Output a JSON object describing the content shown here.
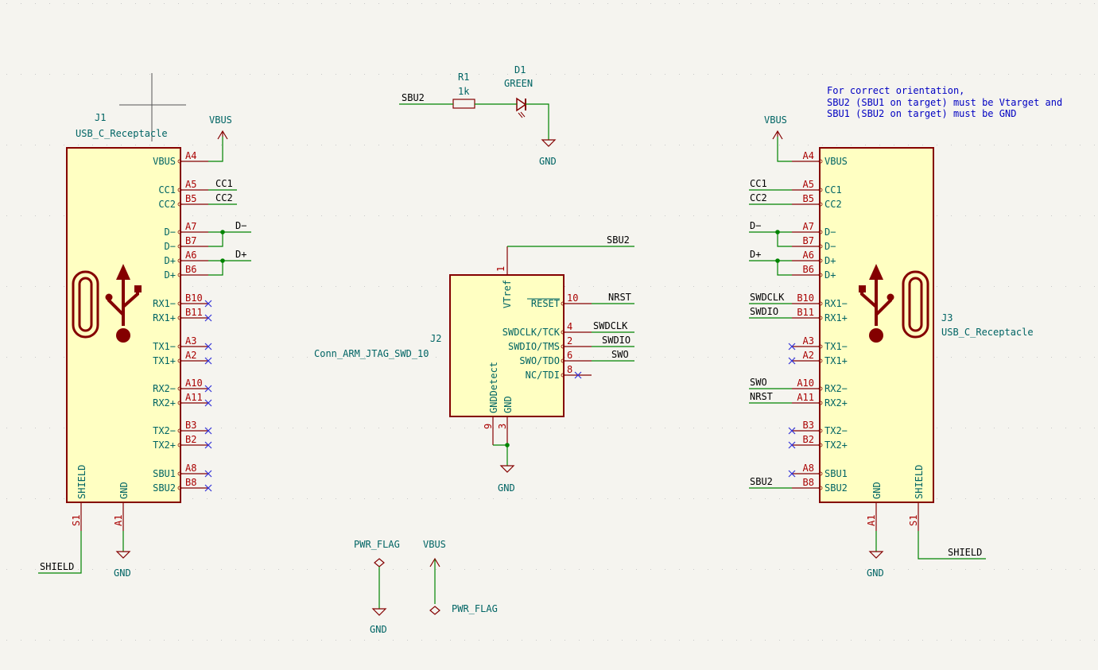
{
  "colors": {
    "background": "#f5f4ef",
    "symbol_body": "#ffffc2",
    "symbol_outline": "#840000",
    "wire": "#008400",
    "pin_number": "#a90000",
    "pin_name": "#006464",
    "note": "#0000c2",
    "no_connect": "#3434d8"
  },
  "j1": {
    "ref": "J1",
    "value": "USB_C_Receptacle",
    "right_pins": [
      {
        "name": "VBUS",
        "num": "A4"
      },
      {
        "name": "CC1",
        "num": "A5"
      },
      {
        "name": "CC2",
        "num": "B5"
      },
      {
        "name": "D−",
        "num": "A7"
      },
      {
        "name": "D−",
        "num": "B7"
      },
      {
        "name": "D+",
        "num": "A6"
      },
      {
        "name": "D+",
        "num": "B6"
      },
      {
        "name": "RX1−",
        "num": "B10"
      },
      {
        "name": "RX1+",
        "num": "B11"
      },
      {
        "name": "TX1−",
        "num": "A3"
      },
      {
        "name": "TX1+",
        "num": "A2"
      },
      {
        "name": "RX2−",
        "num": "A10"
      },
      {
        "name": "RX2+",
        "num": "A11"
      },
      {
        "name": "TX2−",
        "num": "B3"
      },
      {
        "name": "TX2+",
        "num": "B2"
      },
      {
        "name": "SBU1",
        "num": "A8"
      },
      {
        "name": "SBU2",
        "num": "B8"
      }
    ],
    "bottom_pins": [
      {
        "name": "SHIELD",
        "num": "S1"
      },
      {
        "name": "GND",
        "num": "A1"
      }
    ],
    "nets": {
      "vbus": "VBUS",
      "cc1": "CC1",
      "cc2": "CC2",
      "dm": "D−",
      "dp": "D+",
      "shield": "SHIELD",
      "gnd": "GND"
    }
  },
  "j3": {
    "ref": "J3",
    "value": "USB_C_Receptacle",
    "left_pins": [
      {
        "name": "VBUS",
        "num": "A4"
      },
      {
        "name": "CC1",
        "num": "A5"
      },
      {
        "name": "CC2",
        "num": "B5"
      },
      {
        "name": "D−",
        "num": "A7"
      },
      {
        "name": "D−",
        "num": "B7"
      },
      {
        "name": "D+",
        "num": "A6"
      },
      {
        "name": "D+",
        "num": "B6"
      },
      {
        "name": "RX1−",
        "num": "B10"
      },
      {
        "name": "RX1+",
        "num": "B11"
      },
      {
        "name": "TX1−",
        "num": "A3"
      },
      {
        "name": "TX1+",
        "num": "A2"
      },
      {
        "name": "RX2−",
        "num": "A10"
      },
      {
        "name": "RX2+",
        "num": "A11"
      },
      {
        "name": "TX2−",
        "num": "B3"
      },
      {
        "name": "TX2+",
        "num": "B2"
      },
      {
        "name": "SBU1",
        "num": "A8"
      },
      {
        "name": "SBU2",
        "num": "B8"
      }
    ],
    "bottom_pins": [
      {
        "name": "GND",
        "num": "A1"
      },
      {
        "name": "SHIELD",
        "num": "S1"
      }
    ],
    "nets": {
      "vbus": "VBUS",
      "cc1": "CC1",
      "cc2": "CC2",
      "dm": "D−",
      "dp": "D+",
      "swdclk": "SWDCLK",
      "swdio": "SWDIO",
      "swo": "SWO",
      "nrst": "NRST",
      "sbu2": "SBU2",
      "shield": "SHIELD",
      "gnd": "GND"
    }
  },
  "j2": {
    "ref": "J2",
    "value": "Conn_ARM_JTAG_SWD_10",
    "top_pin": {
      "name": "VTref",
      "num": "1"
    },
    "right_pins": [
      {
        "name": "RESET",
        "num": "10"
      },
      {
        "name": "SWDCLK/TCK",
        "num": "4"
      },
      {
        "name": "SWDIO/TMS",
        "num": "2"
      },
      {
        "name": "SWO/TDO",
        "num": "6"
      },
      {
        "name": "NC/TDI",
        "num": "8"
      }
    ],
    "bottom_pins": [
      {
        "name": "GNDDetect",
        "num": "9"
      },
      {
        "name": "GND",
        "num": "3"
      }
    ],
    "nets": {
      "vtref": "SBU2",
      "nrst": "NRST",
      "swdclk": "SWDCLK",
      "swdio": "SWDIO",
      "swo": "SWO",
      "gnd": "GND"
    }
  },
  "r1": {
    "ref": "R1",
    "value": "1k",
    "net": "SBU2"
  },
  "d1": {
    "ref": "D1",
    "value": "GREEN",
    "gnd": "GND"
  },
  "pwr_flags": {
    "flag1": "PWR_FLAG",
    "gnd": "GND",
    "vbus": "VBUS",
    "flag2": "PWR_FLAG"
  },
  "note": {
    "line1": "For correct orientation,",
    "line2": "SBU2 (SBU1 on target) must be Vtarget and",
    "line3": "SBU1 (SBU2 on target) must be GND"
  }
}
